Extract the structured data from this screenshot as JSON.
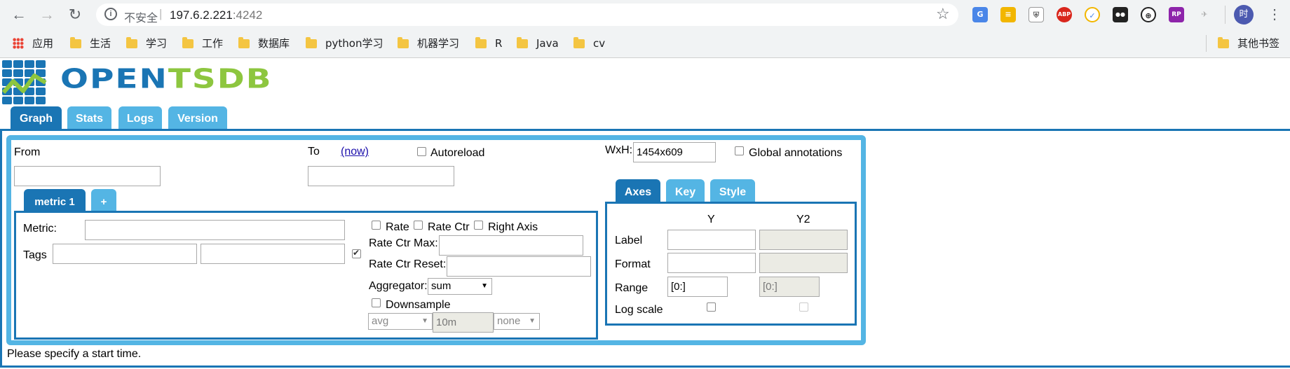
{
  "browser": {
    "security_label": "不安全",
    "url_host": "197.6.2.221",
    "url_port": ":4242",
    "avatar_text": "时",
    "extensions": [
      "G",
      "≡",
      "⛨",
      "ABP",
      "✓",
      "●●",
      "⊕",
      "RP",
      "✈"
    ],
    "bookmarks": [
      "应用",
      "生活",
      "学习",
      "工作",
      "数据库",
      "python学习",
      "机器学习",
      "R",
      "Java",
      "cv"
    ],
    "other_bookmarks": "其他书签"
  },
  "logo": {
    "part1": "OPEN",
    "part2": "TSDB"
  },
  "tabs": [
    "Graph",
    "Stats",
    "Logs",
    "Version"
  ],
  "form": {
    "from_label": "From",
    "to_label": "To",
    "now_link": "(now)",
    "autoreload_label": "Autoreload",
    "wxh_label": "WxH:",
    "wxh_value": "1454x609",
    "global_annotations_label": "Global annotations"
  },
  "metric_tabs": [
    "metric 1",
    "+"
  ],
  "metric": {
    "metric_label": "Metric:",
    "tags_label": "Tags",
    "rate_label": "Rate",
    "rate_ctr_label": "Rate Ctr",
    "right_axis_label": "Right Axis",
    "rate_ctr_max_label": "Rate Ctr Max:",
    "rate_ctr_reset_label": "Rate Ctr Reset:",
    "aggregator_label": "Aggregator:",
    "aggregator_value": "sum",
    "downsample_label": "Downsample",
    "downsample_func": "avg",
    "downsample_interval": "10m",
    "downsample_fill": "none"
  },
  "axes_tabs": [
    "Axes",
    "Key",
    "Style"
  ],
  "axes": {
    "col_y": "Y",
    "col_y2": "Y2",
    "label_row": "Label",
    "format_row": "Format",
    "range_row": "Range",
    "log_scale_row": "Log scale",
    "range_y": "[0:]",
    "range_y2": "[0:]"
  },
  "status": "Please specify a start time."
}
